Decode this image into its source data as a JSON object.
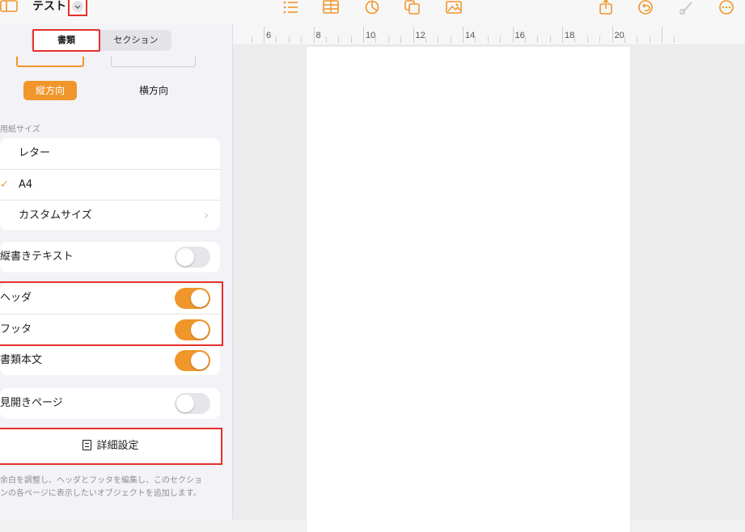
{
  "toolbar": {
    "title": "テスト",
    "icons": [
      "sidebar-icon",
      "chevron-down-icon",
      "list-icon",
      "table-icon",
      "chart-icon",
      "shapes-icon",
      "media-icon",
      "share-icon",
      "undo-icon",
      "brush-icon",
      "more-icon"
    ]
  },
  "ruler": {
    "marks": [
      "6",
      "8",
      "10",
      "12",
      "14",
      "16",
      "18",
      "20"
    ]
  },
  "panel": {
    "tabs": [
      {
        "label": "書類",
        "selected": true
      },
      {
        "label": "セクション",
        "selected": false
      }
    ],
    "orientation": {
      "portrait_label": "縦方向",
      "landscape_label": "横方向",
      "selected": "portrait"
    },
    "paper_size_label": "用紙サイズ",
    "paper_sizes": [
      {
        "label": "レター",
        "checked": false
      },
      {
        "label": "A4",
        "checked": true
      },
      {
        "label": "カスタムサイズ",
        "checked": false
      }
    ],
    "vertical_text": {
      "label": "縦書きテキスト",
      "on": false
    },
    "header": {
      "label": "ヘッダ",
      "on": true
    },
    "footer": {
      "label": "フッタ",
      "on": true
    },
    "body": {
      "label": "書類本文",
      "on": true
    },
    "facing_pages": {
      "label": "見開きページ",
      "on": false
    },
    "advanced_button": "詳細設定",
    "footnote_line1": "余白を調整し、ヘッダとフッタを編集し、このセクショ",
    "footnote_line2": "ンの各ページに表示したいオブジェクトを追加します。"
  },
  "colors": {
    "accent": "#f0962a",
    "highlight": "#e4312c"
  }
}
